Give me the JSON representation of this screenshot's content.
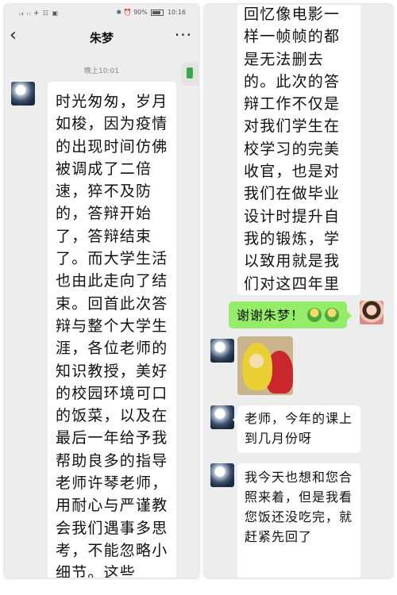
{
  "status_bar": {
    "signal": "ᵢ₄ ᵢₗ ✈ ☷ ▣",
    "right": "✱ ⏰ 90%",
    "time": "10:16"
  },
  "nav": {
    "back": "‹",
    "title": "朱梦",
    "more": "···"
  },
  "timestamp": "晚上10:01",
  "messages": [
    {
      "sender": "朱梦",
      "text": "时光匆匆，岁月如梭，因为疫情的出现时间仿佛被调成了二倍速，猝不及防的，答辩开始了，答辩结束了。而大学生活也由此走向了结束。回首此次答辩与整个大学生涯，各位老师的知识教授，美好的校园环境可口的饭菜，以及在最后一年给予我帮助良多的指导老师许琴老师，用耐心与严谨教会我们遇事多思考，不能忽略小细节。这些"
    },
    {
      "sender": "朱梦",
      "text": "回忆像电影一样一帧帧的都是无法删去的。此次的答辩工作不仅是对我们学生在校学习的完美收官，也是对我们在做毕业设计时提升自我的锻炼，学以致用就是我们对这四年里老师辛苦教授的满分回报。",
      "hearts": "♥♥"
    },
    {
      "sender": "me",
      "text": "谢谢朱梦！"
    },
    {
      "sender": "朱梦",
      "image": "teletubbies-sticker"
    },
    {
      "sender": "朱梦",
      "text": "老师，今年的课上到几月份呀"
    },
    {
      "sender": "朱梦",
      "text": "我今天也想和您合照来着，但是我看您饭还没吃完，就赶紧先回了"
    }
  ],
  "colors": {
    "chat_bg": "#ededed",
    "bubble_in": "#ffffff",
    "bubble_out": "#95ec69"
  }
}
